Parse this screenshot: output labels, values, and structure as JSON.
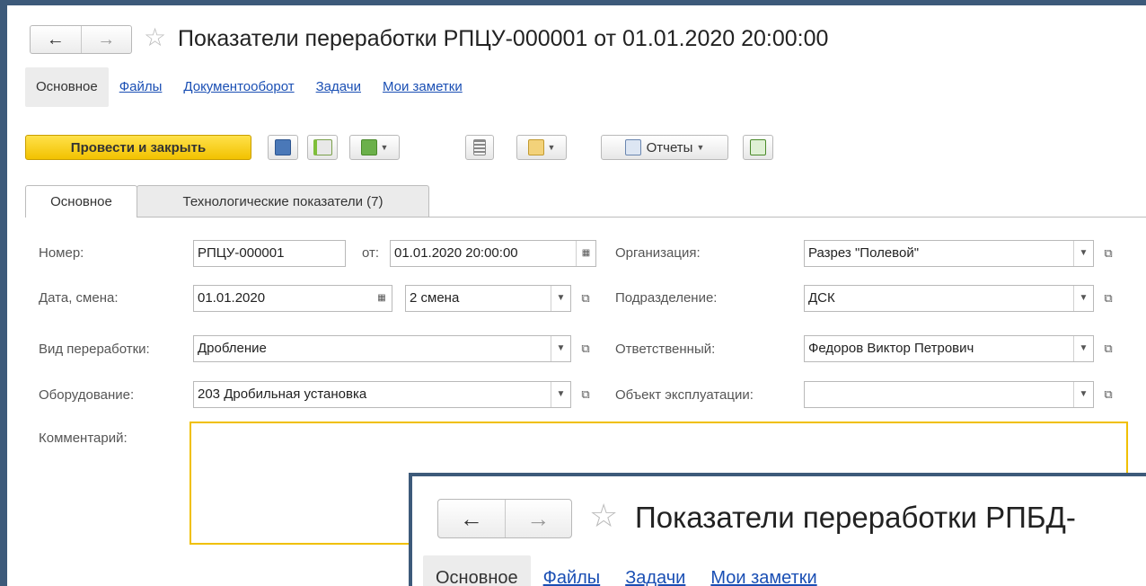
{
  "window": {
    "title": "Показатели переработки РПЦУ-000001 от 01.01.2020 20:00:00",
    "nav": {
      "back": "←",
      "forward": "→"
    },
    "star": "☆"
  },
  "sections": [
    {
      "label": "Основное",
      "active": true
    },
    {
      "label": "Файлы"
    },
    {
      "label": "Документооборот"
    },
    {
      "label": "Задачи"
    },
    {
      "label": "Мои заметки"
    }
  ],
  "toolbar": {
    "post_close": "Провести и закрыть",
    "reports": "Отчеты",
    "icons": [
      "save-icon",
      "post-icon",
      "create-based-icon",
      "list-icon",
      "print-icon",
      "reports-icon",
      "add-icon"
    ]
  },
  "tabs": [
    {
      "label": "Основное",
      "active": true
    },
    {
      "label": "Технологические показатели (7)"
    }
  ],
  "form": {
    "number_label": "Номер:",
    "number_value": "РПЦУ-000001",
    "from_label": "от:",
    "from_value": "01.01.2020 20:00:00",
    "date_label": "Дата, смена:",
    "date_value": "01.01.2020",
    "shift_value": "2 смена",
    "processing_label": "Вид переработки:",
    "processing_value": "Дробление",
    "equipment_label": "Оборудование:",
    "equipment_value": "203 Дробильная установка",
    "comment_label": "Комментарий:",
    "comment_value": "",
    "org_label": "Организация:",
    "org_value": "Разрез \"Полевой\"",
    "dept_label": "Подразделение:",
    "dept_value": "ДСК",
    "resp_label": "Ответственный:",
    "resp_value": "Федоров Виктор Петрович",
    "obj_label": "Объект эксплуатации:",
    "obj_value": ""
  },
  "overlay": {
    "title": "Показатели переработки РПБД-",
    "sections": [
      "Основное",
      "Файлы",
      "Задачи",
      "Мои заметки"
    ]
  },
  "colors": {
    "accent": "#f2c200",
    "link": "#1a4fb4",
    "frame": "#3d5a7a"
  }
}
